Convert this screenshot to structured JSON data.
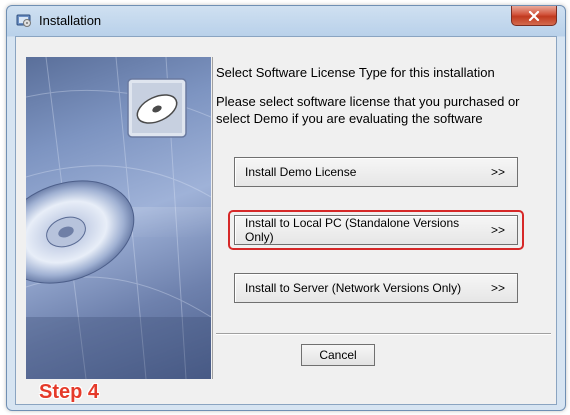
{
  "window": {
    "title": "Installation",
    "close_symbol": "x"
  },
  "icons": {
    "title_icon": "installer-icon",
    "banner_icon": "cd-disc-icon"
  },
  "content": {
    "heading": "Select Software License Type for this installation",
    "description": "Please select software license that you purchased or select Demo if you are evaluating the software"
  },
  "options": [
    {
      "label": "Install Demo License",
      "arrow": ">>"
    },
    {
      "label": "Install to Local PC  (Standalone Versions Only)",
      "arrow": ">>",
      "highlighted": true
    },
    {
      "label": "Install to Server  (Network Versions Only)",
      "arrow": ">>"
    }
  ],
  "cancel_label": "Cancel",
  "annotation": {
    "step_label": "Step 4",
    "highlight_color": "#d62828"
  },
  "colors": {
    "titlebar": "#b9d1ea",
    "client_bg": "#f0f0f0",
    "close_button": "#c13a1f",
    "step_text": "#e53a2a"
  }
}
